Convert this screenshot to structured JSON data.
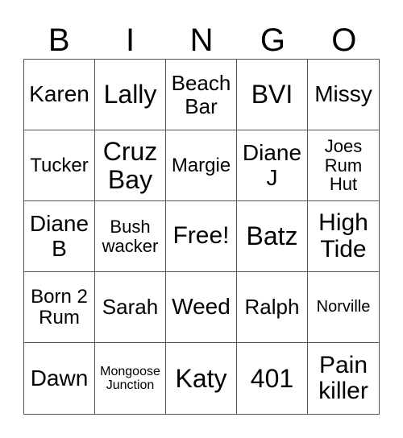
{
  "title_letters": [
    "B",
    "I",
    "N",
    "G",
    "O"
  ],
  "cells": [
    [
      "Karen",
      "Lally",
      "Beach Bar",
      "BVI",
      "Missy"
    ],
    [
      "Tucker",
      "Cruz Bay",
      "Margie",
      "Diane J",
      "Joes Rum Hut"
    ],
    [
      "Diane B",
      "Bush wacker",
      "Free!",
      "Batz",
      "High Tide"
    ],
    [
      "Born 2 Rum",
      "Sarah",
      "Weed",
      "Ralph",
      "Norville"
    ],
    [
      "Dawn",
      "Mongoose Junction",
      "Katy",
      "401",
      "Pain killer"
    ]
  ]
}
